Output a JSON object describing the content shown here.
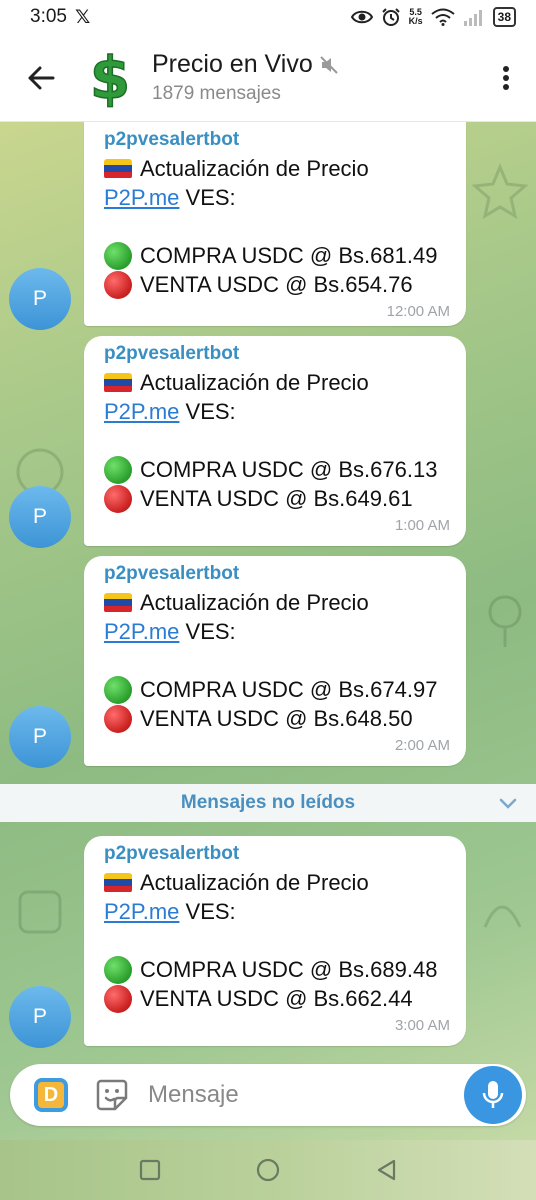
{
  "status_bar": {
    "time": "3:05",
    "x_logo": "𝕏",
    "net_speed_value": "5.5",
    "net_speed_unit": "K/s",
    "battery": "38"
  },
  "header": {
    "back_icon": "arrow-left-icon",
    "channel_emoji": "$",
    "title": "Precio en Vivo",
    "muted_icon": "muted-speaker-icon",
    "subtitle": "1879 mensajes",
    "menu_icon": "more-vert-icon"
  },
  "messages": [
    {
      "sender": "p2pvesalertbot",
      "avatar": "P",
      "line1": "Actualización de Precio",
      "link": "P2P.me",
      "line2_suffix": " VES:",
      "compra": "COMPRA USDC @ Bs.681.49",
      "venta": "VENTA USDC @ Bs.654.76",
      "time": "12:00 AM"
    },
    {
      "sender": "p2pvesalertbot",
      "avatar": "P",
      "line1": "Actualización de Precio",
      "link": "P2P.me",
      "line2_suffix": " VES:",
      "compra": "COMPRA USDC @ Bs.676.13",
      "venta": "VENTA USDC @ Bs.649.61",
      "time": "1:00 AM"
    },
    {
      "sender": "p2pvesalertbot",
      "avatar": "P",
      "line1": "Actualización de Precio",
      "link": "P2P.me",
      "line2_suffix": " VES:",
      "compra": "COMPRA USDC @ Bs.674.97",
      "venta": "VENTA USDC @ Bs.648.50",
      "time": "2:00 AM"
    },
    {
      "sender": "p2pvesalertbot",
      "avatar": "P",
      "line1": "Actualización de Precio",
      "link": "P2P.me",
      "line2_suffix": " VES:",
      "compra": "COMPRA USDC @ Bs.689.48",
      "venta": "VENTA USDC @ Bs.662.44",
      "time": "3:00 AM"
    }
  ],
  "unread_divider": "Mensajes no leídos",
  "composer": {
    "app_icon_letter": "D",
    "placeholder": "Mensaje",
    "sticker_icon": "sticker-icon",
    "attach_icon": "paperclip-icon",
    "mic_icon": "microphone-icon"
  },
  "colors": {
    "sender": "#3a8fc2",
    "link": "#2a7bd3",
    "accent": "#3a96e0",
    "avatar": "#4aa3e0"
  }
}
